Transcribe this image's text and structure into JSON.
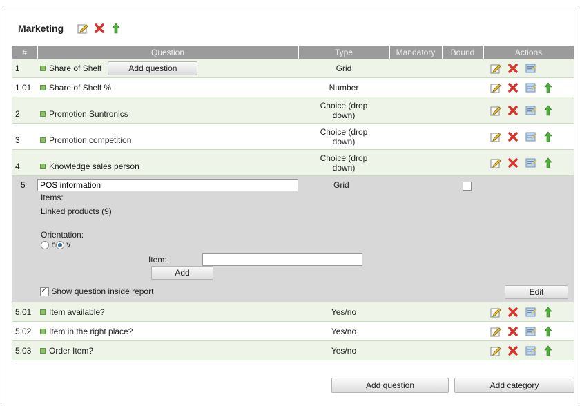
{
  "category": {
    "title": "Marketing"
  },
  "columns": [
    "#",
    "Question",
    "Type",
    "Mandatory",
    "Bound",
    "Actions"
  ],
  "rows": [
    {
      "num": "1",
      "question": "Share of Shelf",
      "type": "Grid",
      "inline_button": "Add question"
    },
    {
      "num": "1.01",
      "question": "Share of Shelf %",
      "type": "Number"
    },
    {
      "num": "2",
      "question": "Promotion Suntronics",
      "type": "Choice (drop down)"
    },
    {
      "num": "3",
      "question": "Promotion competition",
      "type": "Choice (drop down)"
    },
    {
      "num": "4",
      "question": "Knowledge sales person",
      "type": "Choice (drop down)"
    }
  ],
  "edit_row": {
    "num": "5",
    "question_value": "POS information",
    "type": "Grid",
    "items_label": "Items:",
    "linked_products_label": "Linked products",
    "linked_products_count": "(9)",
    "orientation_label": "Orientation:",
    "orientation_h": "h",
    "orientation_v": "v",
    "orientation_selected": "v",
    "item_label": "Item:",
    "item_value": "",
    "add_label": "Add",
    "show_inside_report_label": "Show question inside report",
    "show_inside_report_checked": true,
    "bound_checked": false,
    "edit_label": "Edit"
  },
  "sub_rows": [
    {
      "num": "5.01",
      "question": "Item available?",
      "type": "Yes/no"
    },
    {
      "num": "5.02",
      "question": "Item in the right place?",
      "type": "Yes/no"
    },
    {
      "num": "5.03",
      "question": "Order Item?",
      "type": "Yes/no"
    }
  ],
  "footer": {
    "add_question": "Add question",
    "add_category": "Add category"
  },
  "colors": {
    "header_bg": "#9b9b9b",
    "row_green": "#eef5e8",
    "edit_bg": "#d8d8d8",
    "delete_red": "#d9322b",
    "arrow_green": "#3f9a2c"
  }
}
